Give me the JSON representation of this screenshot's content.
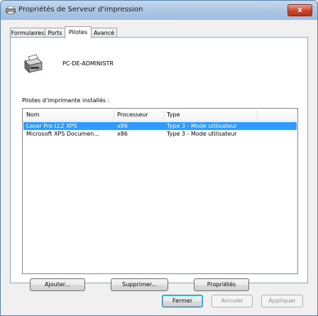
{
  "window": {
    "title": "Propriétés de Serveur d'impression",
    "close_label": "x"
  },
  "tabs": [
    {
      "label": "Formulaires",
      "active": false
    },
    {
      "label": "Ports",
      "active": false
    },
    {
      "label": "Pilotes",
      "active": true
    },
    {
      "label": "Avancé",
      "active": false
    }
  ],
  "server": {
    "name": "PC-DE-ADMINISTR"
  },
  "drivers": {
    "label": "Pilotes d'imprimante installés :",
    "columns": [
      "Nom",
      "Processeur",
      "Type"
    ],
    "rows": [
      {
        "name": "Laser Pro LL2 XPS",
        "processor": "x86",
        "type": "Type 3 - Mode utilisateur",
        "selected": true
      },
      {
        "name": "Microsoft XPS Documen...",
        "processor": "x86",
        "type": "Type 3 - Mode utilisateur",
        "selected": false
      }
    ]
  },
  "panel_buttons": {
    "add": "Ajouter...",
    "remove": "Supprimer...",
    "properties": "Propriétés"
  },
  "dialog_buttons": {
    "close": "Fermer",
    "cancel": "Annuler",
    "apply": "Appliquer"
  },
  "colors": {
    "selection": "#3399ff",
    "title_gradient": "#a9c4e2"
  }
}
